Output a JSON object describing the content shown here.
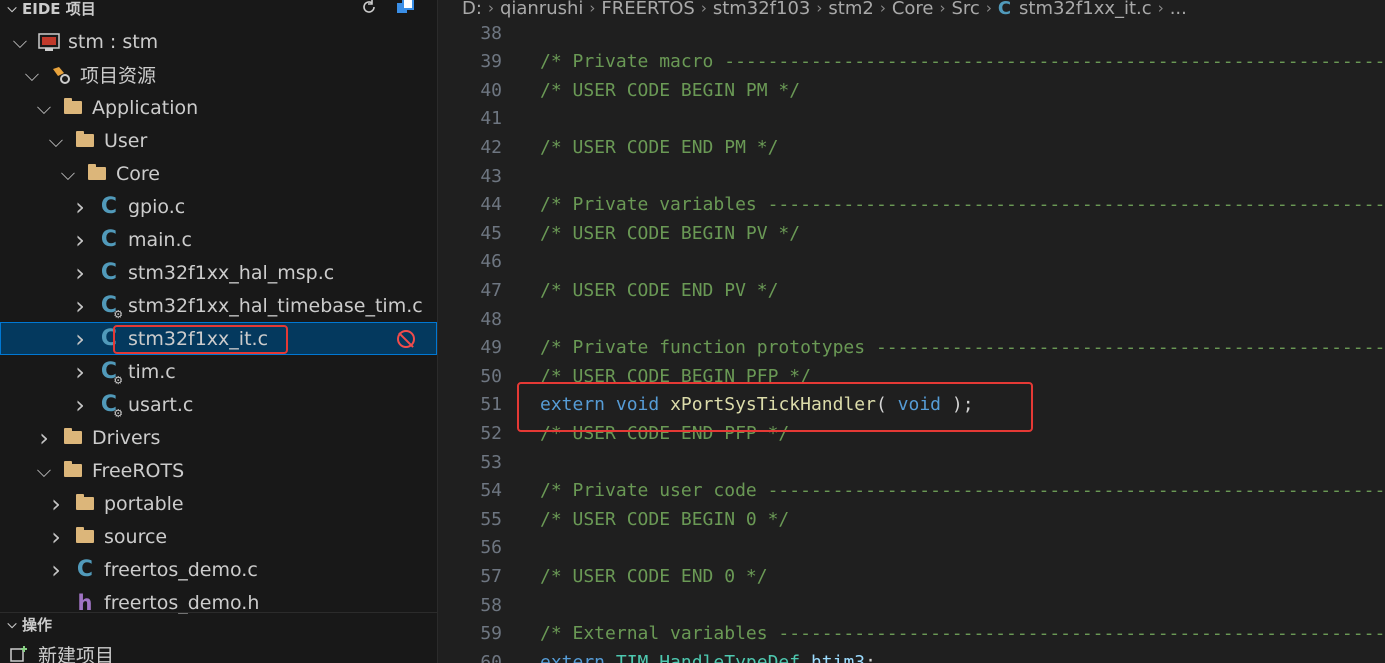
{
  "sidebar": {
    "title": "EIDE 项目",
    "tree": [
      {
        "label": "stm : stm",
        "icon": "project-icon"
      },
      {
        "label": "项目资源",
        "icon": "gear-folder-icon"
      },
      {
        "label": "Application",
        "icon": "folder-icon"
      },
      {
        "label": "User",
        "icon": "folder-icon"
      },
      {
        "label": "Core",
        "icon": "folder-icon"
      },
      {
        "label": "gpio.c",
        "icon": "c-file-icon"
      },
      {
        "label": "main.c",
        "icon": "c-file-icon"
      },
      {
        "label": "stm32f1xx_hal_msp.c",
        "icon": "c-file-icon"
      },
      {
        "label": "stm32f1xx_hal_timebase_tim.c",
        "icon": "c-file-gear-icon"
      },
      {
        "label": "stm32f1xx_it.c",
        "icon": "c-file-icon",
        "selected": true,
        "status": "excluded-icon"
      },
      {
        "label": "tim.c",
        "icon": "c-file-gear-icon"
      },
      {
        "label": "usart.c",
        "icon": "c-file-gear-icon"
      },
      {
        "label": "Drivers",
        "icon": "folder-icon"
      },
      {
        "label": "FreeROTS",
        "icon": "folder-icon"
      },
      {
        "label": "portable",
        "icon": "folder-icon"
      },
      {
        "label": "source",
        "icon": "folder-icon"
      },
      {
        "label": "freertos_demo.c",
        "icon": "c-file-icon"
      },
      {
        "label": "freertos_demo.h",
        "icon": "h-file-icon"
      }
    ],
    "ops_title": "操作",
    "ops_items": [
      {
        "label": "新建项目",
        "icon": "new-project-icon"
      }
    ]
  },
  "breadcrumb": [
    "D:",
    "qianrushi",
    "FREERTOS",
    "stm32f103",
    "stm2",
    "Core",
    "Src",
    "stm32f1xx_it.c",
    "..."
  ],
  "code": {
    "lines": [
      {
        "n": "38",
        "t": ""
      },
      {
        "n": "39",
        "t": "/* Private macro -------------------------------------------------------------"
      },
      {
        "n": "40",
        "t": "/* USER CODE BEGIN PM */"
      },
      {
        "n": "41",
        "t": ""
      },
      {
        "n": "42",
        "t": "/* USER CODE END PM */"
      },
      {
        "n": "43",
        "t": ""
      },
      {
        "n": "44",
        "t": "/* Private variables ---------------------------------------------------------"
      },
      {
        "n": "45",
        "t": "/* USER CODE BEGIN PV */"
      },
      {
        "n": "46",
        "t": ""
      },
      {
        "n": "47",
        "t": "/* USER CODE END PV */"
      },
      {
        "n": "48",
        "t": ""
      },
      {
        "n": "49",
        "t": "/* Private function prototypes -----------------------------------------------"
      },
      {
        "n": "50",
        "t": "/* USER CODE BEGIN PFP */"
      },
      {
        "n": "51",
        "t": "extern void xPortSysTickHandler( void );"
      },
      {
        "n": "52",
        "t": "/* USER CODE END PFP */"
      },
      {
        "n": "53",
        "t": ""
      },
      {
        "n": "54",
        "t": "/* Private user code ---------------------------------------------------------"
      },
      {
        "n": "55",
        "t": "/* USER CODE BEGIN 0 */"
      },
      {
        "n": "56",
        "t": ""
      },
      {
        "n": "57",
        "t": "/* USER CODE END 0 */"
      },
      {
        "n": "58",
        "t": ""
      },
      {
        "n": "59",
        "t": "/* External variables --------------------------------------------------------"
      },
      {
        "n": "60",
        "t": "extern TIM_HandleTypeDef htim3;"
      }
    ],
    "line51_tokens": [
      "extern",
      " ",
      "void",
      " ",
      "xPortSysTickHandler",
      "(",
      " ",
      "void",
      " ",
      ");"
    ],
    "line60_tokens": [
      "extern",
      " ",
      "TIM_HandleTypeDef",
      " ",
      "htim3",
      ";"
    ]
  },
  "colors": {
    "highlight_box": "#e53935",
    "comment": "#6a9955",
    "keyword": "#569cd6",
    "function": "#dcdcaa"
  }
}
